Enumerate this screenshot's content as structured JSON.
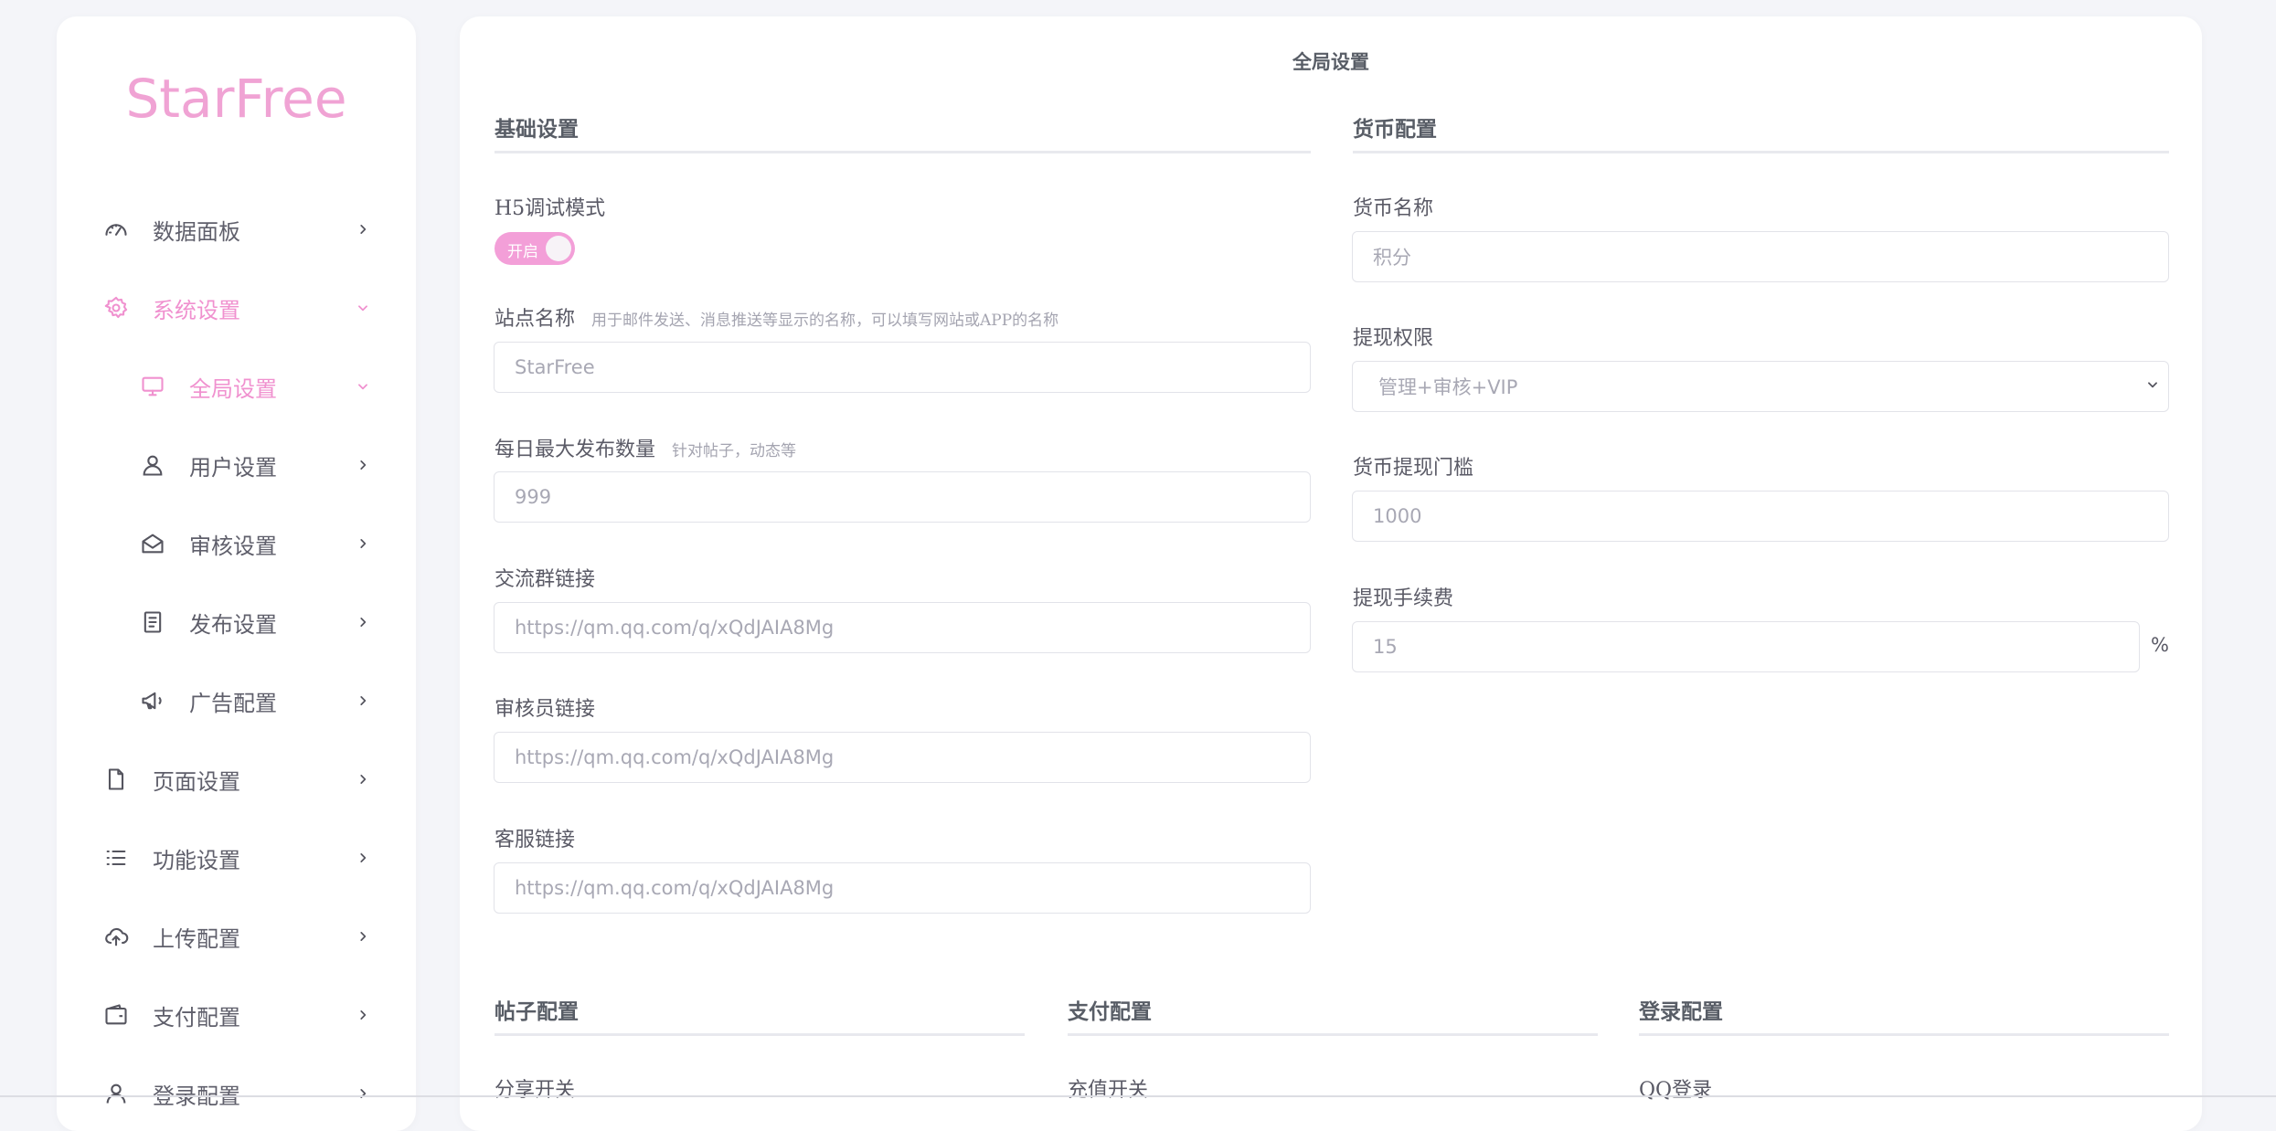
{
  "brand": {
    "logo_text": "StarFree",
    "accent_color": "#f091cf"
  },
  "sidebar": {
    "items": [
      {
        "label": "数据面板",
        "icon": "gauge-icon",
        "active": false
      },
      {
        "label": "系统设置",
        "icon": "gear-icon",
        "active": true,
        "expanded": true
      },
      {
        "label": "全局设置",
        "icon": "monitor-icon",
        "active": true,
        "expanded": true
      },
      {
        "label": "用户设置",
        "icon": "user-icon",
        "active": false
      },
      {
        "label": "审核设置",
        "icon": "mail-open-icon",
        "active": false
      },
      {
        "label": "发布设置",
        "icon": "document-list-icon",
        "active": false
      },
      {
        "label": "广告配置",
        "icon": "megaphone-icon",
        "active": false
      },
      {
        "label": "页面设置",
        "icon": "file-icon",
        "active": false
      },
      {
        "label": "功能设置",
        "icon": "list-icon",
        "active": false
      },
      {
        "label": "上传配置",
        "icon": "cloud-upload-icon",
        "active": false
      },
      {
        "label": "支付配置",
        "icon": "wallet-icon",
        "active": false
      },
      {
        "label": "登录配置",
        "icon": "user-login-icon",
        "active": false
      }
    ]
  },
  "main": {
    "title": "全局设置",
    "basic": {
      "title": "基础设置",
      "h5_debug": {
        "label": "H5调试模式",
        "toggle_text": "开启",
        "on": true
      },
      "site_name": {
        "label": "站点名称",
        "hint": "用于邮件发送、消息推送等显示的名称，可以填写网站或APP的名称",
        "value": "StarFree"
      },
      "daily_max": {
        "label": "每日最大发布数量",
        "hint": "针对帖子，动态等",
        "value": "999"
      },
      "group_link": {
        "label": "交流群链接",
        "value": "https://qm.qq.com/q/xQdJAIA8Mg"
      },
      "reviewer_link": {
        "label": "审核员链接",
        "value": "https://qm.qq.com/q/xQdJAIA8Mg"
      },
      "service_link": {
        "label": "客服链接",
        "value": "https://qm.qq.com/q/xQdJAIA8Mg"
      }
    },
    "currency": {
      "title": "货币配置",
      "name": {
        "label": "货币名称",
        "value": "积分"
      },
      "withdraw_perm": {
        "label": "提现权限",
        "value": "管理+审核+VIP"
      },
      "threshold": {
        "label": "货币提现门槛",
        "value": "1000"
      },
      "fee": {
        "label": "提现手续费",
        "value": "15",
        "suffix": "%"
      }
    },
    "post": {
      "title": "帖子配置",
      "first_label": "分享开关"
    },
    "pay": {
      "title": "支付配置",
      "first_label": "充值开关"
    },
    "login": {
      "title": "登录配置",
      "first_label": "QQ登录"
    }
  }
}
